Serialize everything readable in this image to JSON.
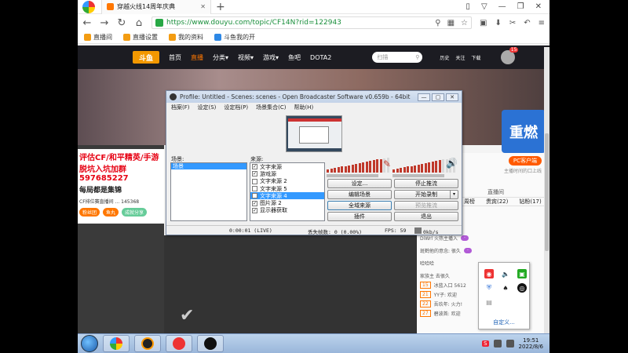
{
  "browser": {
    "tab_title": "穿越火线14周年庆典",
    "url": "https://www.douyu.com/topic/CF14N?rid=122943",
    "bookmarks": [
      "直播间",
      "直播设置",
      "我的资料",
      "斗鱼我的开"
    ]
  },
  "douyu": {
    "logo": "斗鱼",
    "nav": [
      "首页",
      "直播",
      "分类▾",
      "视频▾",
      "游戏▾",
      "鱼吧",
      "DOTA2"
    ],
    "search_placeholder": "扫描",
    "header_icons": [
      "历史",
      "关注",
      "下载"
    ],
    "avatar_badge": "15"
  },
  "page": {
    "ad_line1": "评估CF/和平精英/手游",
    "ad_line2": "脱坑入坑加群597685227",
    "ad_line3": "每局都是集锦",
    "ad_meta": "CF排位赛直播间 ... 145368",
    "ad_btns": [
      "粉丝团",
      "鱼丸",
      "成就分享"
    ],
    "side_banner": "重燃",
    "pc_button": "PC客户端",
    "pc_sub": "主播时间的口上线",
    "live_label": "直播间",
    "chat_tabs": [
      "周榜",
      "贵宾(22)",
      "钻粉(17)"
    ],
    "chat_rows": [
      {
        "lv": "超级",
        "text": "DiWrl 火热主播入"
      },
      {
        "lv": "",
        "text": "斑鹤他的意念: 很久"
      },
      {
        "lv": "",
        "text": "哈哈哈"
      },
      {
        "lv": "",
        "text": "家族主 去很久"
      },
      {
        "lv": "15",
        "text": "冰蓝入口 5612"
      },
      {
        "lv": "21",
        "text": "YY子: 欢迎"
      },
      {
        "lv": "22",
        "text": "吾玖年: 火力!"
      },
      {
        "lv": "27",
        "text": "碧波首: 欢迎"
      }
    ]
  },
  "obs": {
    "title": "Profile: Untitled - Scenes: scenes - Open Broadcaster Software v0.659b - 64bit",
    "menu": [
      "档案(F)",
      "设定(S)",
      "设定档(P)",
      "场景集合(C)",
      "帮助(H)"
    ],
    "scenes_label": "场景:",
    "sources_label": "来源:",
    "scenes": [
      "场景"
    ],
    "sources": [
      {
        "name": "文字来源",
        "checked": true,
        "selected": false
      },
      {
        "name": "游戏源",
        "checked": true,
        "selected": false
      },
      {
        "name": "文字来源 2",
        "checked": false,
        "selected": false
      },
      {
        "name": "文字来源 5",
        "checked": false,
        "selected": false
      },
      {
        "name": "文字来源 4",
        "checked": true,
        "selected": true
      },
      {
        "name": "图片源 2",
        "checked": true,
        "selected": false
      },
      {
        "name": "显示器获取",
        "checked": true,
        "selected": false
      }
    ],
    "buttons": {
      "settings": "设定...",
      "stop_stream": "停止推流",
      "edit_scene": "编辑场景",
      "start_record": "开始录制",
      "global_sources": "全域来源",
      "preview_stream": "预览推流",
      "plugins": "插件",
      "exit": "退出"
    },
    "status": {
      "time": "0:00:01 (LIVE)",
      "dropped": "丢失帧数: 0 (0.00%)",
      "fps": "FPS: 59",
      "kbps": "0kb/s"
    },
    "mic_level": 0.85,
    "desktop_level": 0.75
  },
  "tray_popup": {
    "customize": "自定义..."
  },
  "taskbar": {
    "time": "19:51",
    "date": "2022/8/6"
  }
}
